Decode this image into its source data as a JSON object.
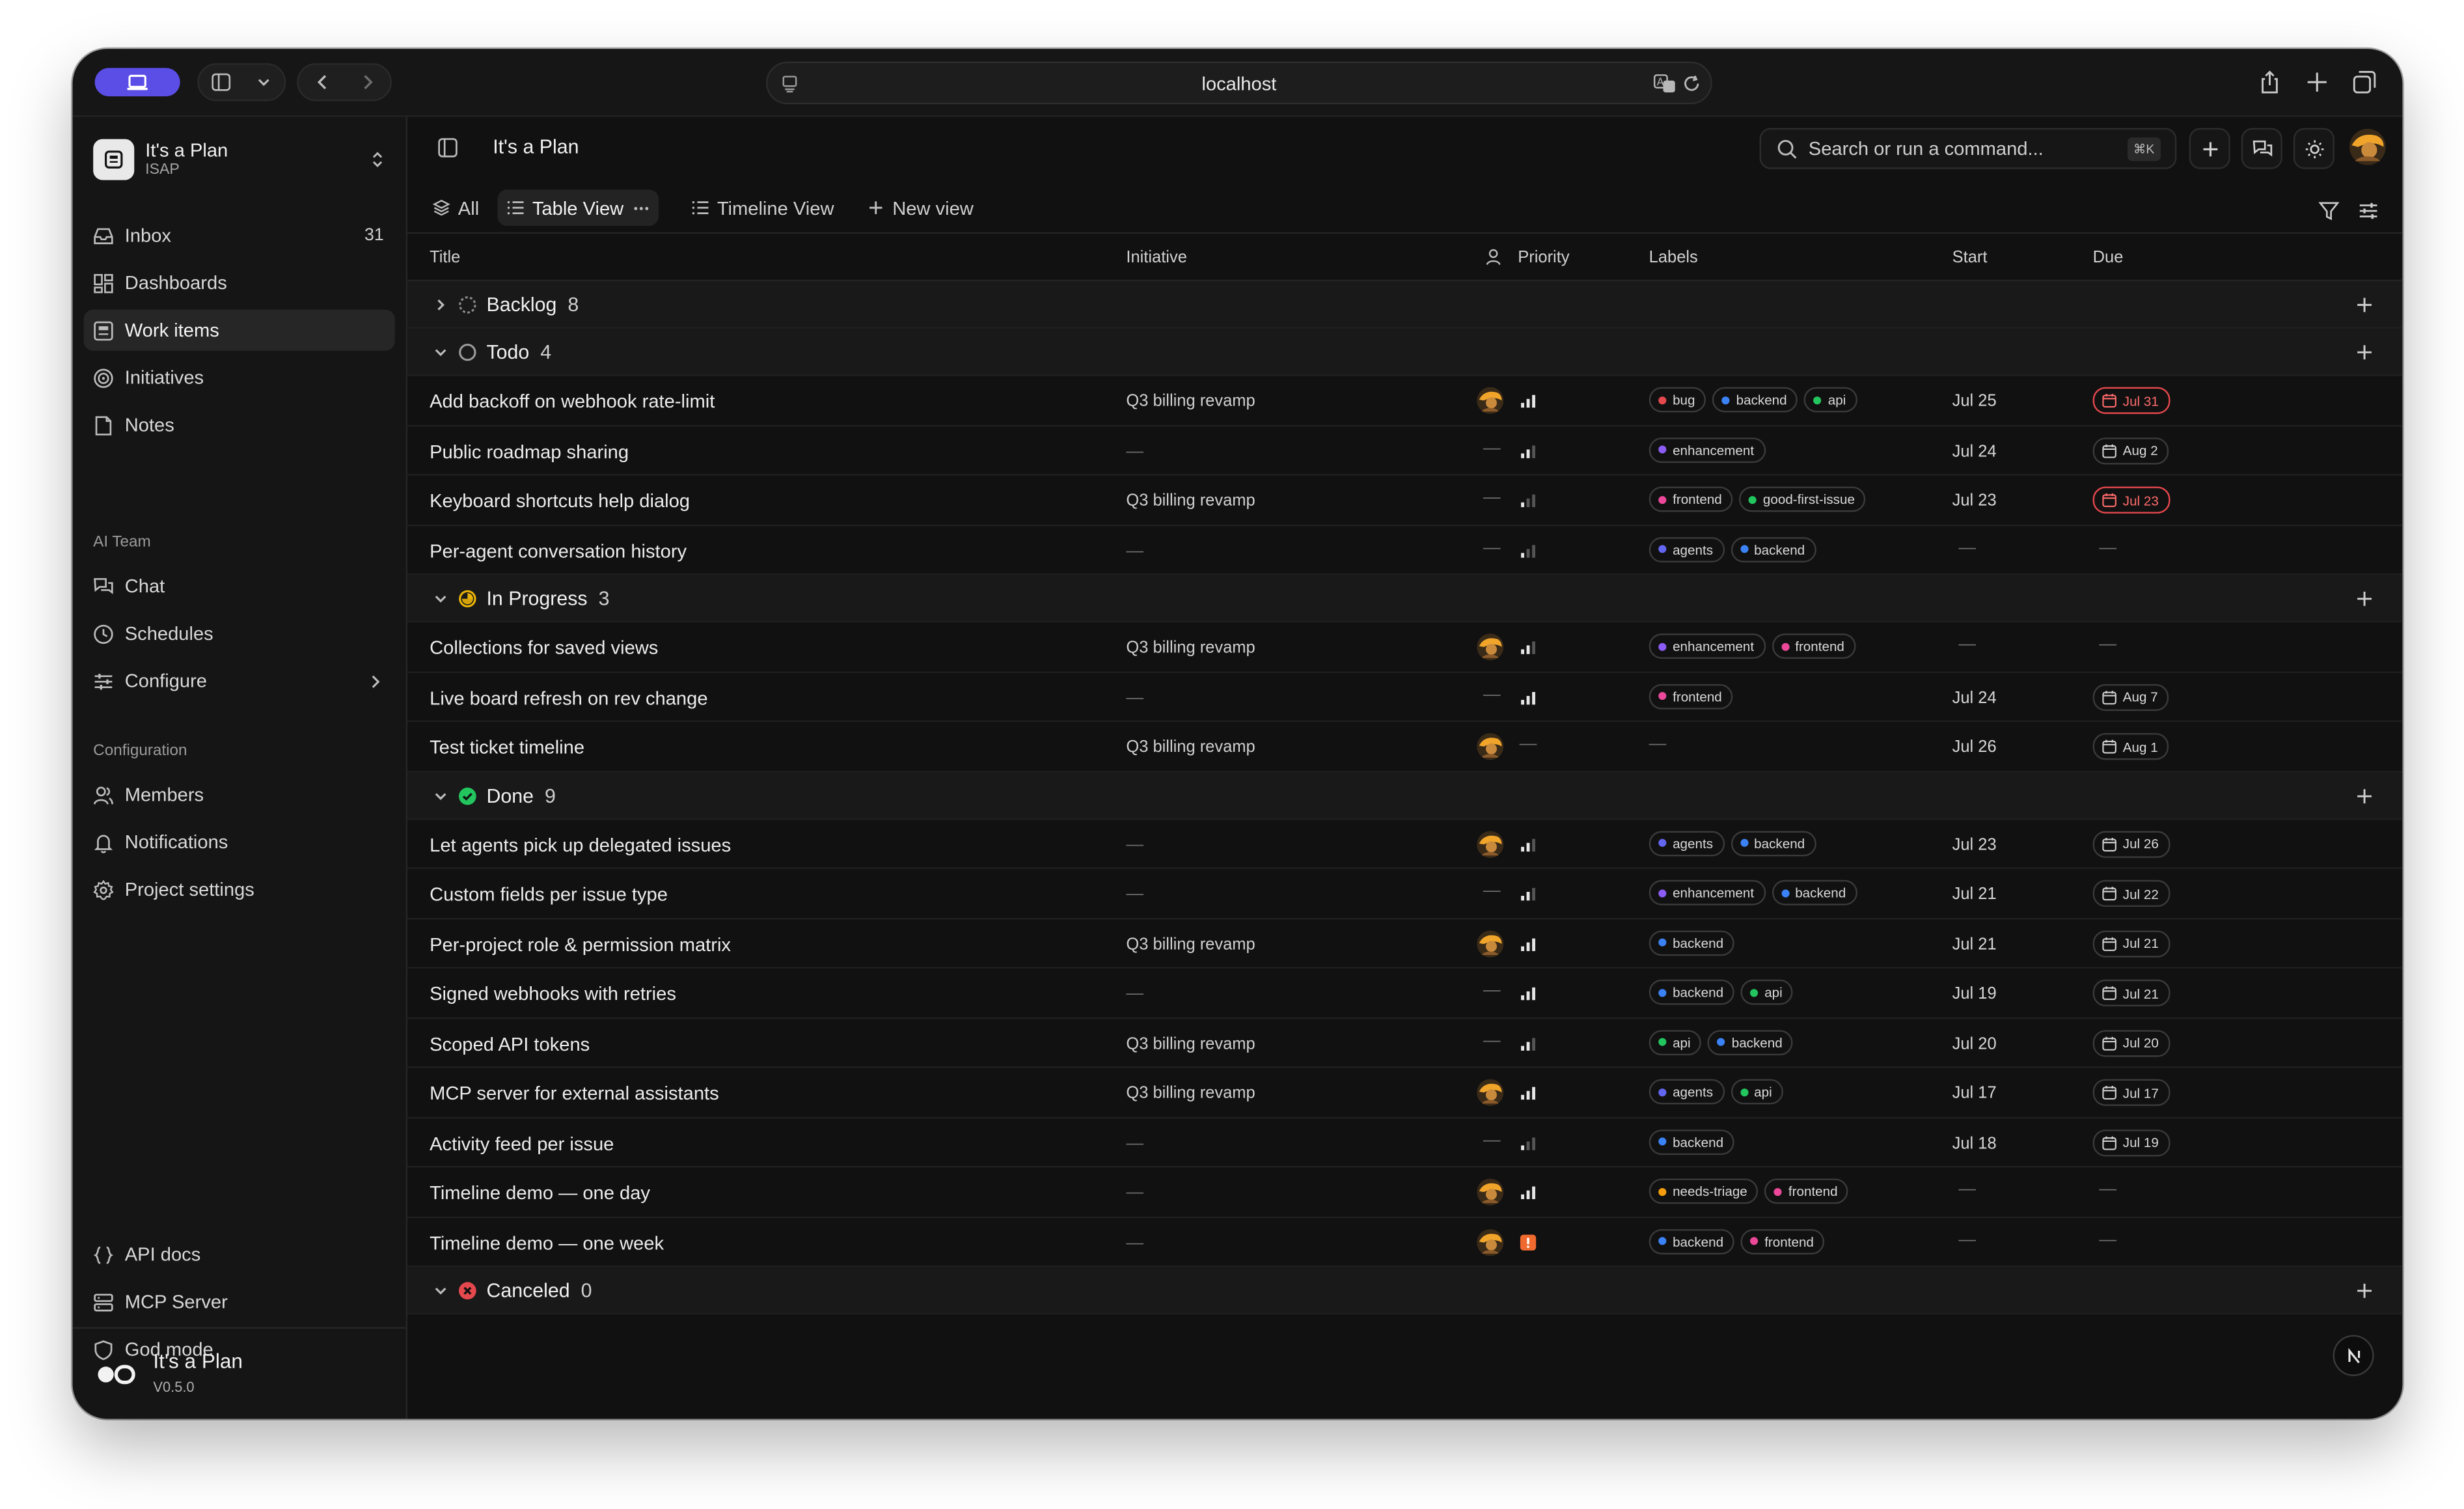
{
  "browser": {
    "url": "localhost"
  },
  "workspace": {
    "name": "It's a Plan",
    "code": "ISAP"
  },
  "nav_main": [
    {
      "label": "Inbox",
      "count": "31",
      "icon": "inbox-icon"
    },
    {
      "label": "Dashboards",
      "icon": "dashboard-icon"
    },
    {
      "label": "Work items",
      "icon": "work-items-icon",
      "active": true
    },
    {
      "label": "Initiatives",
      "icon": "target-icon"
    },
    {
      "label": "Notes",
      "icon": "note-icon"
    }
  ],
  "ai_team": {
    "label": "AI Team",
    "items": [
      {
        "label": "Chat",
        "icon": "chat-icon"
      },
      {
        "label": "Schedules",
        "icon": "clock-icon"
      },
      {
        "label": "Configure",
        "icon": "sliders-icon"
      }
    ]
  },
  "configuration": {
    "label": "Configuration",
    "items": [
      {
        "label": "Members",
        "icon": "users-icon"
      },
      {
        "label": "Notifications",
        "icon": "bell-icon"
      },
      {
        "label": "Project settings",
        "icon": "gear-icon"
      }
    ]
  },
  "nav_bottom": [
    {
      "label": "API docs",
      "icon": "braces-icon"
    },
    {
      "label": "MCP Server",
      "icon": "server-icon"
    },
    {
      "label": "God mode",
      "icon": "shield-icon"
    }
  ],
  "footer": {
    "name": "It's a Plan",
    "version": "V0.5.0"
  },
  "header": {
    "title": "It's a Plan",
    "search_placeholder": "Search or run a command...",
    "shortcut": "⌘K"
  },
  "views": [
    {
      "label": "All"
    },
    {
      "label": "Table View",
      "active": true
    },
    {
      "label": "Timeline View"
    },
    {
      "label": "New view"
    }
  ],
  "columns": {
    "title": "Title",
    "initiative": "Initiative",
    "priority": "Priority",
    "labels": "Labels",
    "start": "Start",
    "due": "Due"
  },
  "dash": "—",
  "groups": [
    {
      "name": "Backlog",
      "count": "8",
      "status": "backlog",
      "expanded": false,
      "items": []
    },
    {
      "name": "Todo",
      "count": "4",
      "status": "todo",
      "expanded": true,
      "items": [
        {
          "title": "Add backoff on webhook rate-limit",
          "initiative": "Q3 billing revamp",
          "assignee": true,
          "priority": "high",
          "labels": [
            "bug",
            "backend",
            "api"
          ],
          "start": "Jul 25",
          "due": "Jul 31",
          "overdue": true
        },
        {
          "title": "Public roadmap sharing",
          "initiative": "",
          "assignee": false,
          "priority": "medium",
          "labels": [
            "enhancement"
          ],
          "start": "Jul 24",
          "due": "Aug 2",
          "overdue": false
        },
        {
          "title": "Keyboard shortcuts help dialog",
          "initiative": "Q3 billing revamp",
          "assignee": false,
          "priority": "low",
          "labels": [
            "frontend",
            "good-first-issue"
          ],
          "start": "Jul 23",
          "due": "Jul 23",
          "overdue": true
        },
        {
          "title": "Per-agent conversation history",
          "initiative": "",
          "assignee": false,
          "priority": "low",
          "labels": [
            "agents",
            "backend"
          ],
          "start": "",
          "due": "",
          "overdue": false
        }
      ]
    },
    {
      "name": "In Progress",
      "count": "3",
      "status": "in-progress",
      "expanded": true,
      "items": [
        {
          "title": "Collections for saved views",
          "initiative": "Q3 billing revamp",
          "assignee": true,
          "priority": "medium",
          "labels": [
            "enhancement",
            "frontend"
          ],
          "start": "",
          "due": "",
          "overdue": false
        },
        {
          "title": "Live board refresh on rev change",
          "initiative": "",
          "assignee": false,
          "priority": "high",
          "labels": [
            "frontend"
          ],
          "start": "Jul 24",
          "due": "Aug 7",
          "overdue": false
        },
        {
          "title": "Test ticket timeline",
          "initiative": "Q3 billing revamp",
          "assignee": true,
          "priority": "none",
          "labels": [],
          "start": "Jul 26",
          "due": "Aug 1",
          "overdue": false
        }
      ]
    },
    {
      "name": "Done",
      "count": "9",
      "status": "done",
      "expanded": true,
      "items": [
        {
          "title": "Let agents pick up delegated issues",
          "initiative": "",
          "assignee": true,
          "priority": "medium",
          "labels": [
            "agents",
            "backend"
          ],
          "start": "Jul 23",
          "due": "Jul 26",
          "overdue": false
        },
        {
          "title": "Custom fields per issue type",
          "initiative": "",
          "assignee": false,
          "priority": "medium",
          "labels": [
            "enhancement",
            "backend"
          ],
          "start": "Jul 21",
          "due": "Jul 22",
          "overdue": false
        },
        {
          "title": "Per-project role & permission matrix",
          "initiative": "Q3 billing revamp",
          "assignee": true,
          "priority": "high",
          "labels": [
            "backend"
          ],
          "start": "Jul 21",
          "due": "Jul 21",
          "overdue": false
        },
        {
          "title": "Signed webhooks with retries",
          "initiative": "",
          "assignee": false,
          "priority": "high",
          "labels": [
            "backend",
            "api"
          ],
          "start": "Jul 19",
          "due": "Jul 21",
          "overdue": false
        },
        {
          "title": "Scoped API tokens",
          "initiative": "Q3 billing revamp",
          "assignee": false,
          "priority": "medium",
          "labels": [
            "api",
            "backend"
          ],
          "start": "Jul 20",
          "due": "Jul 20",
          "overdue": false
        },
        {
          "title": "MCP server for external assistants",
          "initiative": "Q3 billing revamp",
          "assignee": true,
          "priority": "high",
          "labels": [
            "agents",
            "api"
          ],
          "start": "Jul 17",
          "due": "Jul 17",
          "overdue": false
        },
        {
          "title": "Activity feed per issue",
          "initiative": "",
          "assignee": false,
          "priority": "low",
          "labels": [
            "backend"
          ],
          "start": "Jul 18",
          "due": "Jul 19",
          "overdue": false
        },
        {
          "title": "Timeline demo — one day",
          "initiative": "",
          "assignee": true,
          "priority": "high",
          "labels": [
            "needs-triage",
            "frontend"
          ],
          "start": "",
          "due": "",
          "overdue": false
        },
        {
          "title": "Timeline demo — one week",
          "initiative": "",
          "assignee": true,
          "priority": "urgent",
          "labels": [
            "backend",
            "frontend"
          ],
          "start": "",
          "due": "",
          "overdue": false
        }
      ]
    },
    {
      "name": "Canceled",
      "count": "0",
      "status": "canceled",
      "expanded": true,
      "items": []
    }
  ],
  "label_colors": {
    "bug": "#e5484d",
    "backend": "#3b82f6",
    "api": "#22c55e",
    "enhancement": "#8b5cf6",
    "frontend": "#ec4899",
    "good-first-issue": "#22c55e",
    "agents": "#6366f1",
    "needs-triage": "#f59e0b"
  },
  "colors": {
    "accent": "#5b4ee6",
    "overdue": "#e5484d",
    "in_progress": "#eab308",
    "done": "#22c55e",
    "canceled": "#e5484d"
  },
  "fab_label": "N"
}
